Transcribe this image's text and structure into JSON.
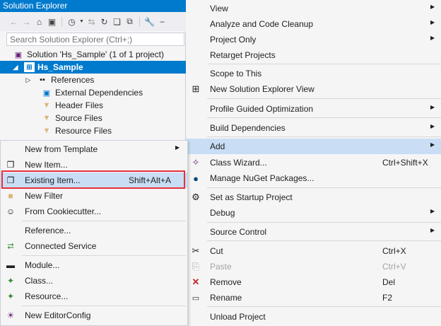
{
  "solution_explorer": {
    "title": "Solution Explorer",
    "search_placeholder": "Search Solution Explorer (Ctrl+;)",
    "solution_label": "Solution 'Hs_Sample' (1 of 1 project)",
    "project_label": "Hs_Sample",
    "nodes": [
      "References",
      "External Dependencies",
      "Header Files",
      "Source Files",
      "Resource Files"
    ]
  },
  "context_menu": {
    "view": "View",
    "analyze": "Analyze and Code Cleanup",
    "project_only": "Project Only",
    "retarget": "Retarget Projects",
    "scope": "Scope to This",
    "new_se_view": "New Solution Explorer View",
    "pgo": "Profile Guided Optimization",
    "build_deps": "Build Dependencies",
    "add": "Add",
    "class_wizard": "Class Wizard...",
    "class_wizard_shortcut": "Ctrl+Shift+X",
    "nuget": "Manage NuGet Packages...",
    "startup": "Set as Startup Project",
    "debug": "Debug",
    "source_control": "Source Control",
    "cut": "Cut",
    "cut_shortcut": "Ctrl+X",
    "paste": "Paste",
    "paste_shortcut": "Ctrl+V",
    "remove": "Remove",
    "remove_shortcut": "Del",
    "rename": "Rename",
    "rename_shortcut": "F2",
    "unload": "Unload Project"
  },
  "add_submenu": {
    "new_from_template": "New from Template",
    "new_item": "New Item...",
    "existing_item": "Existing Item...",
    "existing_item_shortcut": "Shift+Alt+A",
    "new_filter": "New Filter",
    "from_cookiecutter": "From Cookiecutter...",
    "reference": "Reference...",
    "connected_service": "Connected Service",
    "module": "Module...",
    "class": "Class...",
    "resource": "Resource...",
    "new_editorconfig": "New EditorConfig"
  },
  "colors": {
    "accent": "#007acc",
    "highlight": "#c9def5",
    "callout": "#e8303a"
  }
}
